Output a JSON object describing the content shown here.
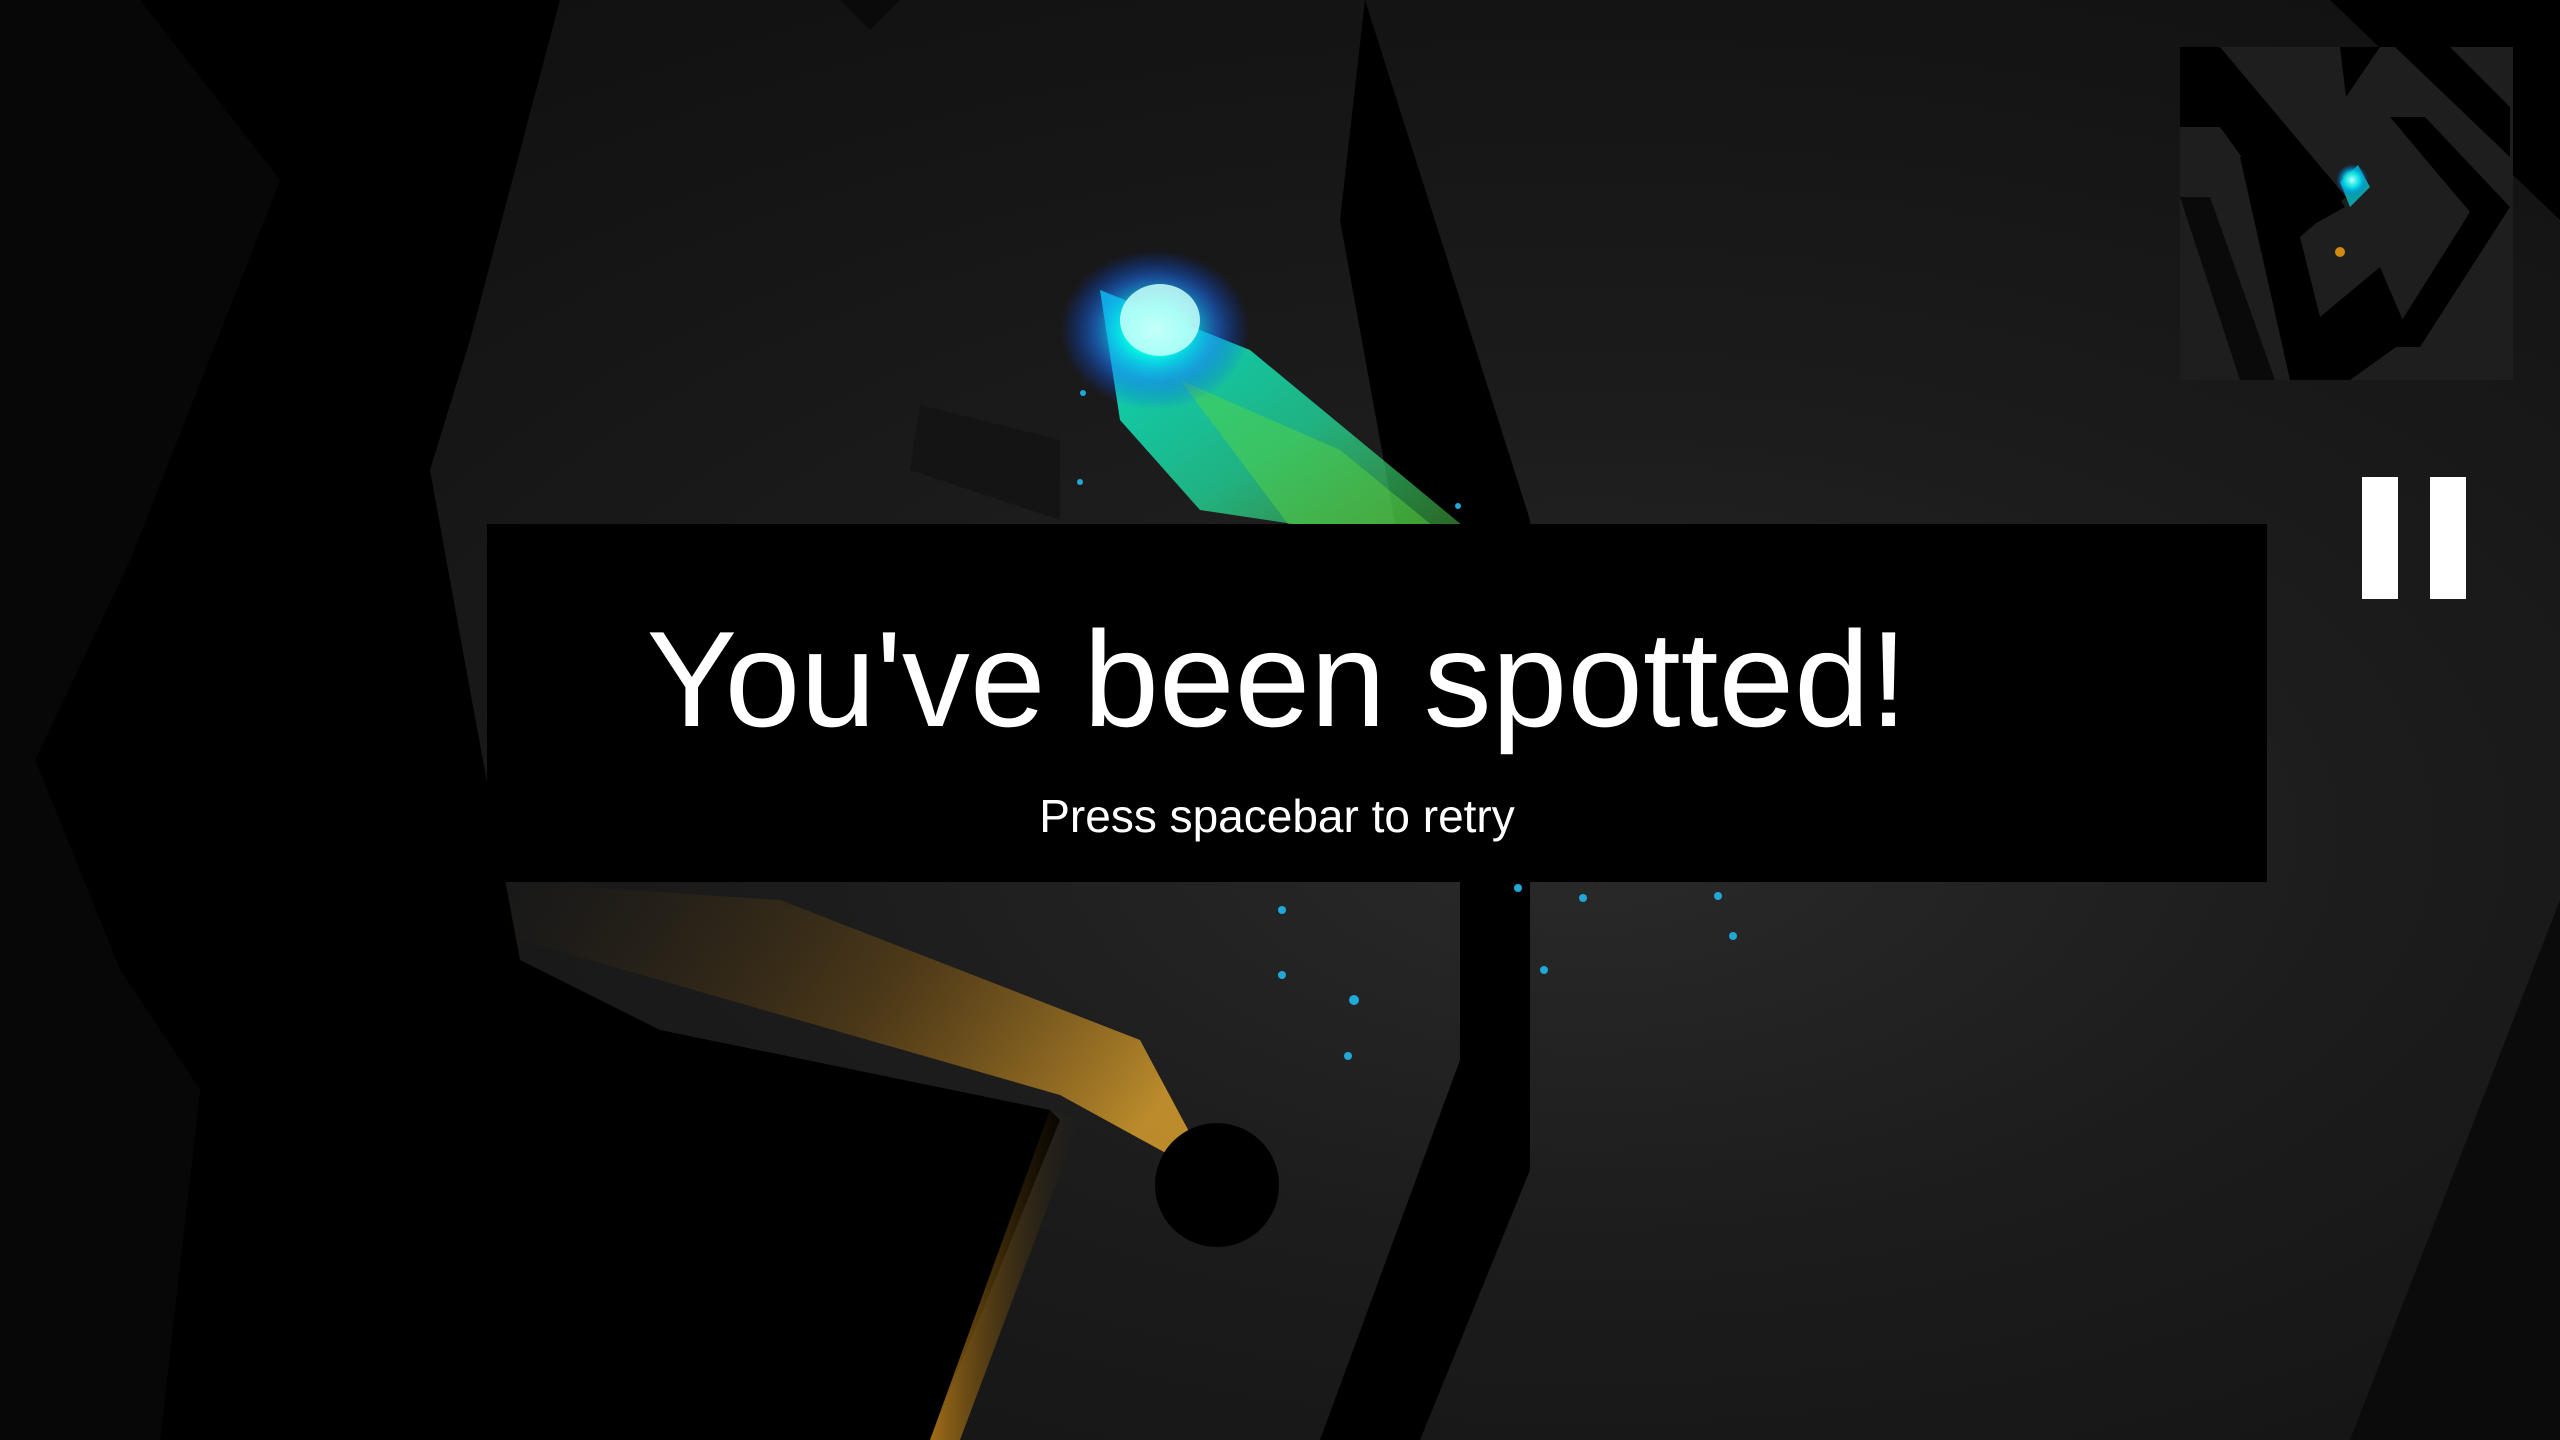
{
  "overlay": {
    "title": "You've been spotted!",
    "subtitle": "Press spacebar to retry"
  },
  "hud": {
    "pause_icon": "pause-icon",
    "minimap_icon": "minimap"
  },
  "colors": {
    "player_glow": "#00ffe6",
    "player_trail": "#3fe07a",
    "enemy_light": "#e0a020",
    "wall": "#000000",
    "floor": "#1c1c1c",
    "banner": "#000000",
    "text": "#ffffff"
  }
}
